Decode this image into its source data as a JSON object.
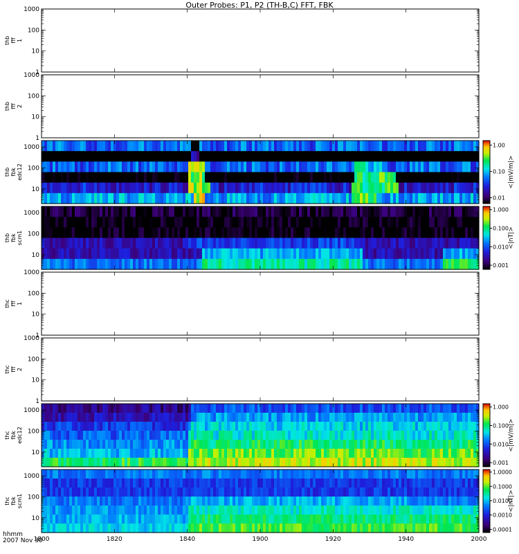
{
  "title": "Outer Probes: P1, P2 (TH-B,C) FFT, FBK",
  "time_axis": {
    "ticks": [
      "1800",
      "1820",
      "1840",
      "1900",
      "1920",
      "1940",
      "2000"
    ],
    "label_line1": "hhmm",
    "label_line2": "2007 Nov 30"
  },
  "chart_data": [
    {
      "type": "heatmap",
      "panel_label": [
        "thb",
        "fff",
        "1"
      ],
      "y_scale": "log",
      "ylim": [
        1,
        1000
      ],
      "y_ticks": [
        "1",
        "10",
        "100",
        "1000"
      ],
      "empty": true
    },
    {
      "type": "heatmap",
      "panel_label": [
        "thb",
        "fff",
        "2"
      ],
      "y_scale": "log",
      "ylim": [
        1,
        1000
      ],
      "y_ticks": [
        "1",
        "10",
        "100",
        "1000"
      ],
      "empty": true
    },
    {
      "type": "heatmap",
      "panel_label": [
        "thb",
        "fbk",
        "edc12"
      ],
      "y_scale": "log",
      "ylim": [
        2,
        2000
      ],
      "y_ticks": [
        "10",
        "100",
        "1000"
      ],
      "colorbar": {
        "label": "<|mV/m|>",
        "ticks": [
          "1.00",
          "0.10",
          "0.01"
        ]
      },
      "rows": [
        {
          "level": 0.05,
          "ev": [
            [
              "1841",
              "1843",
              0.002
            ]
          ]
        },
        {
          "level": 0.003,
          "ev": [
            [
              "1841",
              "1843",
              0.02
            ]
          ]
        },
        {
          "level": 0.05,
          "ev": [
            [
              "1840",
              "1845",
              0.35
            ],
            [
              "1926",
              "1935",
              0.12
            ]
          ]
        },
        {
          "level": 0.004,
          "ev": [
            [
              "1840",
              "1845",
              0.35
            ],
            [
              "1926",
              "1937",
              0.25
            ]
          ]
        },
        {
          "level": 0.025,
          "ev": [
            [
              "1840",
              "1846",
              0.5
            ],
            [
              "1925",
              "1938",
              0.25
            ]
          ]
        },
        {
          "level": 0.08,
          "ev": [
            [
              "1842",
              "1845",
              0.6
            ],
            [
              "1925",
              "1932",
              0.3
            ]
          ]
        }
      ]
    },
    {
      "type": "heatmap",
      "panel_label": [
        "thb",
        "fbk",
        "scm1"
      ],
      "y_scale": "log",
      "ylim": [
        2,
        2000
      ],
      "y_ticks": [
        "10",
        "100",
        "1000"
      ],
      "colorbar": {
        "label": "<|nT|>",
        "ticks": [
          "1.000",
          "0.100",
          "0.010",
          "0.001"
        ]
      },
      "rows": [
        {
          "level": 0.0009,
          "ev": []
        },
        {
          "level": 0.0006,
          "ev": []
        },
        {
          "level": 0.0006,
          "ev": []
        },
        {
          "level": 0.003,
          "ev": [
            [
              "1840",
              "1929",
              0.008
            ]
          ]
        },
        {
          "level": 0.003,
          "ev": [
            [
              "1844",
              "1928",
              0.025
            ],
            [
              "1950",
              "2000",
              0.025
            ]
          ]
        },
        {
          "level": 0.015,
          "ev": [
            [
              "1844",
              "1928",
              0.07
            ],
            [
              "1950",
              "2000",
              0.12
            ]
          ]
        }
      ]
    },
    {
      "type": "heatmap",
      "panel_label": [
        "thc",
        "fff",
        "1"
      ],
      "y_scale": "log",
      "ylim": [
        1,
        1000
      ],
      "y_ticks": [
        "1",
        "10",
        "100",
        "1000"
      ],
      "empty": true
    },
    {
      "type": "heatmap",
      "panel_label": [
        "thc",
        "fff",
        "2"
      ],
      "y_scale": "log",
      "ylim": [
        1,
        1000
      ],
      "y_ticks": [
        "1",
        "10",
        "100",
        "1000"
      ],
      "empty": true
    },
    {
      "type": "heatmap",
      "panel_label": [
        "thc",
        "fbk",
        "edc12"
      ],
      "y_scale": "log",
      "ylim": [
        2,
        2000
      ],
      "y_ticks": [
        "10",
        "100",
        "1000"
      ],
      "colorbar": {
        "label": "<|mV/m|>",
        "ticks": [
          "1.000",
          "0.100",
          "0.010",
          "0.001"
        ]
      },
      "rows": [
        {
          "level": 0.002,
          "ev": [
            [
              "1841",
              "2000",
              0.01
            ]
          ]
        },
        {
          "level": 0.003,
          "ev": [
            [
              "1841",
              "2000",
              0.02
            ]
          ]
        },
        {
          "level": 0.007,
          "ev": [
            [
              "1840",
              "2000",
              0.035
            ]
          ]
        },
        {
          "level": 0.012,
          "ev": [
            [
              "1840",
              "2000",
              0.05
            ]
          ]
        },
        {
          "level": 0.02,
          "ev": [
            [
              "1840",
              "2000",
              0.1
            ]
          ]
        },
        {
          "level": 0.03,
          "ev": [
            [
              "1840",
              "2000",
              0.18
            ]
          ]
        },
        {
          "level": 0.12,
          "ev": [
            [
              "1840",
              "2000",
              0.3
            ]
          ]
        }
      ]
    },
    {
      "type": "heatmap",
      "panel_label": [
        "thc",
        "fbk",
        "scm1"
      ],
      "y_scale": "log",
      "ylim": [
        2,
        2000
      ],
      "y_ticks": [
        "10",
        "100",
        "1000"
      ],
      "colorbar": {
        "label": "<|nT|>",
        "ticks": [
          "1.0000",
          "0.1000",
          "0.0100",
          "0.0010",
          "0.0001"
        ]
      },
      "rows": [
        {
          "level": 0.004,
          "ev": []
        },
        {
          "level": 0.0015,
          "ev": []
        },
        {
          "level": 0.0015,
          "ev": []
        },
        {
          "level": 0.004,
          "ev": [
            [
              "1840",
              "1941",
              0.008
            ]
          ]
        },
        {
          "level": 0.006,
          "ev": [
            [
              "1840",
              "2000",
              0.02
            ]
          ]
        },
        {
          "level": 0.008,
          "ev": [
            [
              "1840",
              "2000",
              0.04
            ]
          ]
        },
        {
          "level": 0.012,
          "ev": [
            [
              "1840",
              "2000",
              0.08
            ]
          ]
        }
      ]
    }
  ]
}
